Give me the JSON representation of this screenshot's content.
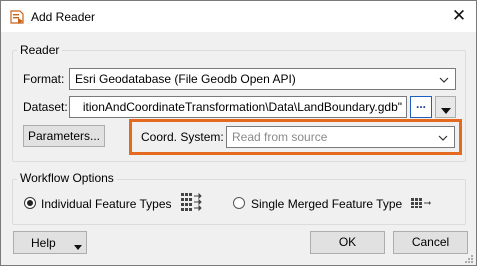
{
  "window": {
    "title": "Add Reader",
    "close_glyph": "✕",
    "icon": "add-reader-icon"
  },
  "reader": {
    "group_label": "Reader",
    "format_label": "Format:",
    "format_value": "Esri Geodatabase (File Geodb Open API)",
    "dataset_label": "Dataset:",
    "dataset_value": "itionAndCoordinateTransformation\\Data\\LandBoundary.gdb\"",
    "browse_label": "...",
    "parameters_label": "Parameters...",
    "coord_system_label": "Coord. System:",
    "coord_system_placeholder": "Read from source"
  },
  "workflow": {
    "group_label": "Workflow Options",
    "option_individual": "Individual Feature Types",
    "option_merged": "Single Merged Feature Type",
    "selected": "individual"
  },
  "footer": {
    "help_label": "Help",
    "ok_label": "OK",
    "cancel_label": "Cancel"
  },
  "colors": {
    "highlight": "#e36a1e",
    "browse_accent": "#1f5fbf"
  }
}
